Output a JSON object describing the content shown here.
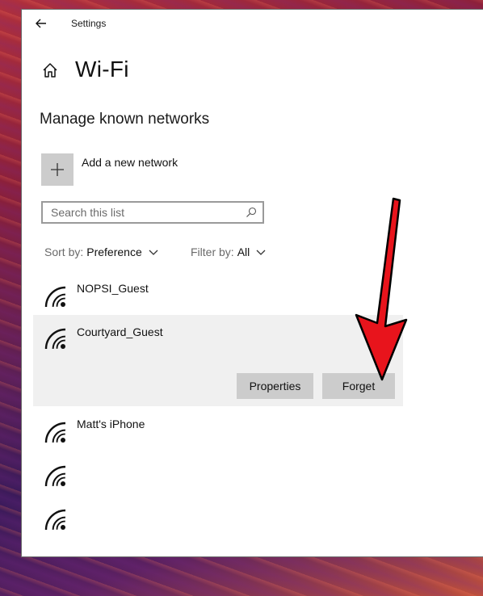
{
  "window": {
    "title": "Settings"
  },
  "header": {
    "page_title": "Wi-Fi"
  },
  "section": {
    "title": "Manage known networks"
  },
  "add_network": {
    "label": "Add a new network"
  },
  "search": {
    "placeholder": "Search this list",
    "value": ""
  },
  "sort": {
    "label": "Sort by:",
    "value": "Preference"
  },
  "filter": {
    "label": "Filter by:",
    "value": "All"
  },
  "networks": [
    {
      "name": "NOPSI_Guest",
      "selected": false
    },
    {
      "name": "Courtyard_Guest",
      "selected": true
    },
    {
      "name": "Matt's iPhone",
      "selected": false
    },
    {
      "name": "",
      "selected": false
    },
    {
      "name": "",
      "selected": false
    }
  ],
  "actions": {
    "properties_label": "Properties",
    "forget_label": "Forget"
  },
  "icons": [
    "back-arrow-icon",
    "home-icon",
    "plus-icon",
    "search-icon",
    "chevron-down-icon",
    "wifi-icon",
    "red-arrow"
  ],
  "colors": {
    "accent_arrow": "#e8141c",
    "selected_bg": "#f0f0f0",
    "button_bg": "#cccccc"
  }
}
